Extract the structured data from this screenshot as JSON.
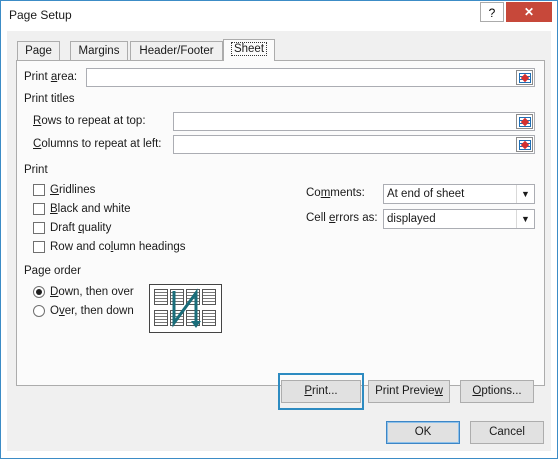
{
  "window": {
    "title": "Page Setup",
    "help": "?",
    "close": "✕"
  },
  "tabs": [
    {
      "label": "Page"
    },
    {
      "label": "Margins"
    },
    {
      "label": "Header/Footer"
    },
    {
      "label": "Sheet",
      "active": true
    }
  ],
  "print_area": {
    "label_pre": "Print ",
    "label_u": "a",
    "label_post": "rea:",
    "value": ""
  },
  "print_titles": {
    "heading": "Print titles",
    "rows": {
      "label_u": "R",
      "label_post": "ows to repeat at top:",
      "value": ""
    },
    "cols": {
      "label_u": "C",
      "label_post": "olumns to repeat at left:",
      "value": ""
    }
  },
  "print_section": {
    "heading": "Print",
    "checkboxes": [
      {
        "pre": "",
        "u": "G",
        "post": "ridlines",
        "checked": false
      },
      {
        "pre": "",
        "u": "B",
        "post": "lack and white",
        "checked": false
      },
      {
        "pre": "Draft ",
        "u": "q",
        "post": "uality",
        "checked": false
      },
      {
        "pre": "Row and co",
        "u": "l",
        "post": "umn headings",
        "checked": false
      }
    ],
    "comments": {
      "pre": "Co",
      "u": "m",
      "post": "ments:",
      "value": "At end of sheet"
    },
    "cell_errors": {
      "pre": "Cell ",
      "u": "e",
      "post": "rrors as:",
      "value": "displayed"
    }
  },
  "page_order": {
    "heading": "Page order",
    "options": [
      {
        "pre": "",
        "u": "D",
        "post": "own, then over",
        "checked": true
      },
      {
        "pre": "O",
        "u": "v",
        "post": "er, then down",
        "checked": false
      }
    ]
  },
  "buttons": {
    "print": {
      "pre": "",
      "u": "P",
      "post": "rint..."
    },
    "preview": {
      "pre": "Print Previe",
      "u": "w",
      "post": ""
    },
    "options": {
      "pre": "",
      "u": "O",
      "post": "ptions..."
    },
    "ok": "OK",
    "cancel": "Cancel"
  },
  "colors": {
    "accent": "#2d8bc1",
    "close_bg": "#c7483a",
    "arrow": "#1a6d7a"
  }
}
